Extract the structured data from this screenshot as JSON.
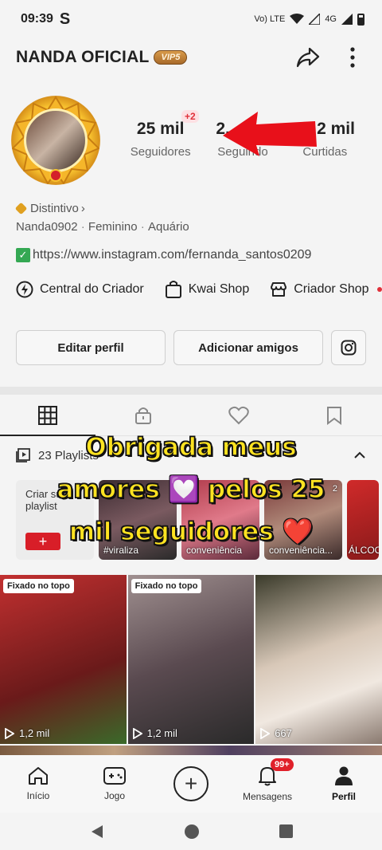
{
  "status_bar": {
    "time": "09:39",
    "carrier_icon": "S",
    "network": "Vo) LTE",
    "signal": "4G"
  },
  "header": {
    "title": "NANDA OFICIAL",
    "vip": "VIP5",
    "share_icon": "share-icon",
    "more_icon": "more-vertical-icon"
  },
  "stats": [
    {
      "value": "25 mil",
      "label": "Seguidores",
      "badge": "+2"
    },
    {
      "value": "2,",
      "label": "Seguindo"
    },
    {
      "value": "2 mil",
      "label": "Curtidas"
    }
  ],
  "profile": {
    "badge_label": "Distintivo",
    "username": "Nanda0902",
    "gender": "Feminino",
    "sign": "Aquário",
    "link": "https://www.instagram.com/fernanda_santos0209"
  },
  "shortcuts": [
    {
      "label": "Central do Criador",
      "icon": "lightning-icon"
    },
    {
      "label": "Kwai Shop",
      "icon": "bag-icon"
    },
    {
      "label": "Criador Shop",
      "icon": "store-icon"
    }
  ],
  "actions": {
    "edit": "Editar perfil",
    "add_friends": "Adicionar amigos"
  },
  "playlists": {
    "header": "23 Playlists",
    "create_label": "Criar sua playlist",
    "create_plus": "+",
    "items": [
      {
        "caption": "#viraliza",
        "count": ""
      },
      {
        "caption": "conveniência",
        "count": ""
      },
      {
        "caption": "conveniência...",
        "count": "2"
      },
      {
        "caption": "ÁLCOOL",
        "count": ""
      }
    ]
  },
  "overlay": {
    "line1": "Obrigada meus",
    "line2": "amores 💟 pelos 25",
    "line3": "mil seguidores ❤️"
  },
  "videos": [
    {
      "pin": "Fixado no topo",
      "views": "1,2 mil",
      "colors": [
        "#c23030",
        "#7a1a1a"
      ]
    },
    {
      "pin": "Fixado no topo",
      "views": "1,2 mil",
      "colors": [
        "#9a8a8a",
        "#4a3a40"
      ]
    },
    {
      "pin": "",
      "views": "667",
      "colors": [
        "#d8c8b8",
        "#6a5a50"
      ]
    }
  ],
  "bottom_nav": [
    {
      "label": "Início",
      "icon": "home-icon"
    },
    {
      "label": "Jogo",
      "icon": "gamepad-icon"
    },
    {
      "label": "",
      "icon": "plus-icon"
    },
    {
      "label": "Mensagens",
      "icon": "bell-icon",
      "badge": "99+"
    },
    {
      "label": "Perfil",
      "icon": "person-icon"
    }
  ]
}
